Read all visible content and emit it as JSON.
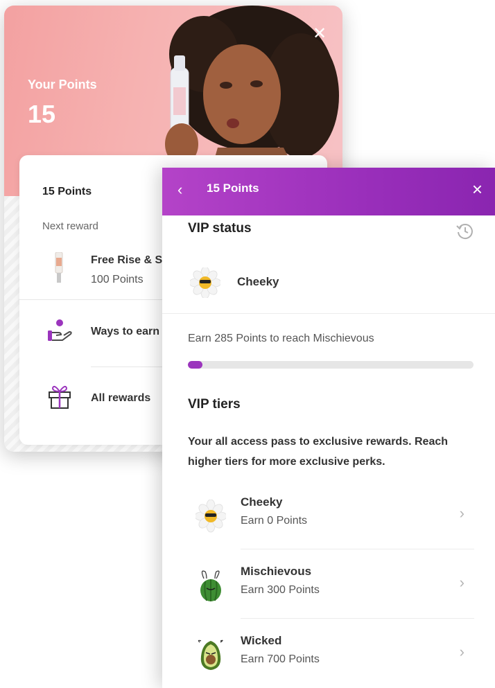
{
  "back_widget": {
    "points_label": "Your Points",
    "points_value": "15",
    "card": {
      "points_summary": "15 Points",
      "next_reward_label": "Next reward",
      "reward_name": "Free Rise & S",
      "reward_cost": "100 Points",
      "ways_to_earn_label": "Ways to earn",
      "all_rewards_label": "All rewards"
    }
  },
  "panel": {
    "header": {
      "back_icon": "chevron-left-icon",
      "title": "15 Points",
      "close_icon": "close-icon"
    },
    "vip_status": {
      "heading": "VIP status",
      "history_icon": "history-icon",
      "current_tier": "Cheeky",
      "earn_message": "Earn 285 Points to reach Mischievous",
      "progress_fraction": 0.05
    },
    "vip_tiers": {
      "heading": "VIP tiers",
      "description": "Your all access pass to exclusive rewards. Reach higher tiers for more exclusive perks.",
      "tiers": [
        {
          "name": "Cheeky",
          "earn": "Earn 0 Points",
          "icon": "daisy-icon"
        },
        {
          "name": "Mischievous",
          "earn": "Earn 300 Points",
          "icon": "watermelon-icon"
        },
        {
          "name": "Wicked",
          "earn": "Earn 700 Points",
          "icon": "avocado-icon"
        }
      ]
    }
  },
  "colors": {
    "accent": "#9b35bd",
    "hero_pink": "#f4a7a8"
  }
}
